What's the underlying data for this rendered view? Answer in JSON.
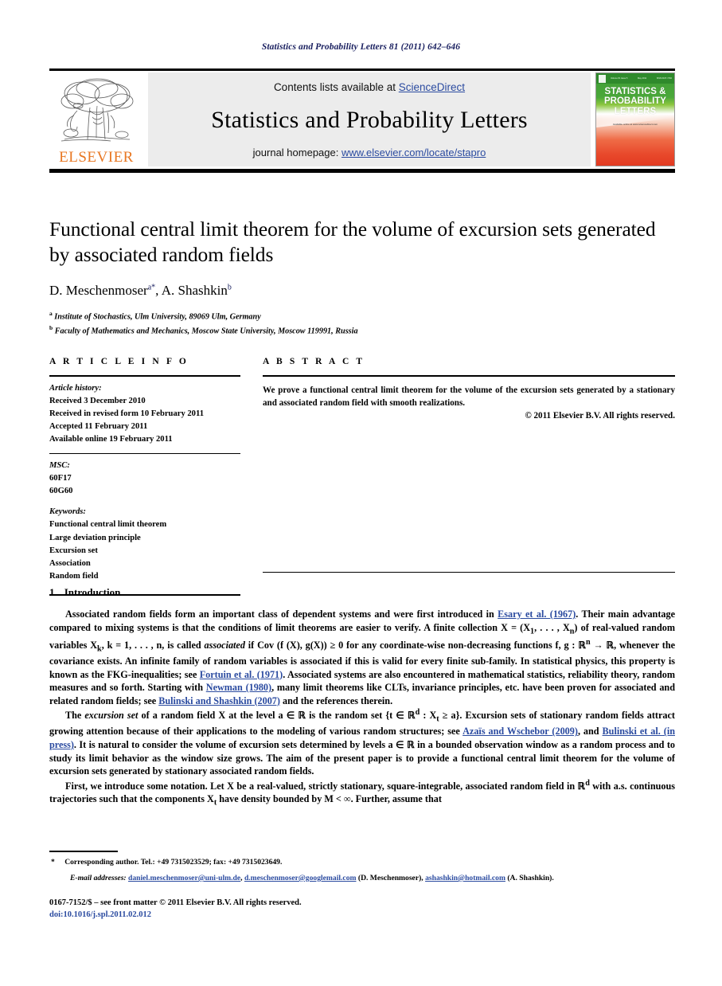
{
  "running_head": "Statistics and Probability Letters 81 (2011) 642–646",
  "masthead": {
    "contents_prefix": "Contents lists available at ",
    "sciencedirect": "ScienceDirect",
    "journal_title": "Statistics and Probability Letters",
    "homepage_prefix": "journal homepage: ",
    "homepage_url": "www.elsevier.com/locate/stapro",
    "publisher": "ELSEVIER",
    "cover": {
      "line1": "STATISTICS &",
      "line2": "PROBABILITY",
      "line3": "LETTERS",
      "bar_left": "Volume 81 Issue 5",
      "bar_mid": "May 2011",
      "bar_right": "ISSN 0167-7152",
      "footer": "Available online at www.sciencedirect.com"
    },
    "link_color": "#2b4ba0",
    "elsevier_orange": "#E87722"
  },
  "title": "Functional central limit theorem for the volume of excursion sets generated by associated random fields",
  "authors": {
    "a1_name": "D. Meschenmoser",
    "a1_sup": "a",
    "a1_star": "*",
    "sep": ", ",
    "a2_name": "A. Shashkin",
    "a2_sup": "b"
  },
  "affiliations": [
    {
      "mark": "a",
      "text": "Institute of Stochastics, Ulm University, 89069 Ulm, Germany"
    },
    {
      "mark": "b",
      "text": "Faculty of Mathematics and Mechanics, Moscow State University, Moscow 119991, Russia"
    }
  ],
  "article_info": {
    "heading": "A R T I C L E    I N F O",
    "history_label": "Article history:",
    "history": [
      "Received 3 December 2010",
      "Received in revised form 10 February 2011",
      "Accepted 11 February 2011",
      "Available online 19 February 2011"
    ],
    "msc_label": "MSC:",
    "msc": [
      "60F17",
      "60G60"
    ],
    "keywords_label": "Keywords:",
    "keywords": [
      "Functional central limit theorem",
      "Large deviation principle",
      "Excursion set",
      "Association",
      "Random field"
    ]
  },
  "abstract": {
    "heading": "A B S T R A C T",
    "text": "We prove a functional central limit theorem for the volume of the excursion sets generated by a stationary and associated random field with smooth realizations.",
    "copyright": "© 2011 Elsevier B.V. All rights reserved."
  },
  "section": {
    "number": "1.",
    "title": "Introduction"
  },
  "paragraphs": {
    "p1": {
      "t1": "Associated random fields form an important class of dependent systems and were first introduced in ",
      "l1": "Esary et al. (1967)",
      "t2": ". Their main advantage compared to mixing systems is that the conditions of limit theorems are easier to verify. A finite collection X = (X",
      "t3": ", . . . , X",
      "t4": ") of real-valued random variables X",
      "t5": ", k = 1, . . . , n, is called ",
      "i1": "associated",
      "t6": " if Cov (f (X), g(X)) ≥ 0 for any coordinate-wise non-decreasing functions f, g : ℝ",
      "t7": " → ℝ, whenever the covariance exists. An infinite family of random variables is associated if this is valid for every finite sub-family. In statistical physics, this property is known as the FKG-inequalities; see ",
      "l2": "Fortuin et al. (1971)",
      "t8": ". Associated systems are also encountered in mathematical statistics, reliability theory, random measures and so forth. Starting with ",
      "l3": "Newman (1980)",
      "t9": ", many limit theorems like CLTs, invariance principles, etc. have been proven for associated and related random fields; see ",
      "l4": "Bulinski and Shashkin (2007)",
      "t10": " and the references therein."
    },
    "p2": {
      "t1": "The ",
      "i1": "excursion set",
      "t2": " of a random field X at the level a ∈ ℝ is the random set {t ∈ ℝ",
      "t3": " : X",
      "t4": " ≥ a}. Excursion sets of stationary random fields attract growing attention because of their applications to the modeling of various random structures; see ",
      "l1": "Azaïs and Wschebor (2009)",
      "t5": ", and ",
      "l2": "Bulinski et al. (in press)",
      "t6": ". It is natural to consider the volume of excursion sets determined by levels a ∈ ℝ in a bounded observation window as a random process and to study its limit behavior as the window size grows. The aim of the present paper is to provide a functional central limit theorem for the volume of excursion sets generated by stationary associated random fields."
    },
    "p3": {
      "t1": "First, we introduce some notation. Let X be a real-valued, strictly stationary, square-integrable, associated random field in ℝ",
      "t2": " with a.s. continuous trajectories such that the components X",
      "t3": " have density bounded by M < ∞. Further, assume that"
    }
  },
  "footnotes": {
    "star": "*",
    "corresponding": " Corresponding author. Tel.: +49 7315023529; fax: +49 7315023649.",
    "email_label": "E-mail addresses:",
    "email1": "daniel.meschenmoser@uni-ulm.de",
    "email_sep1": ", ",
    "email2": "d.meschenmoser@googlemail.com",
    "email_owner1": " (D. Meschenmoser), ",
    "email3": "ashashkin@hotmail.com",
    "email_owner2": " (A. Shashkin)."
  },
  "imprint": {
    "issn_line": "0167-7152/$ – see front matter © 2011 Elsevier B.V. All rights reserved.",
    "doi_line": "doi:10.1016/j.spl.2011.02.012"
  }
}
